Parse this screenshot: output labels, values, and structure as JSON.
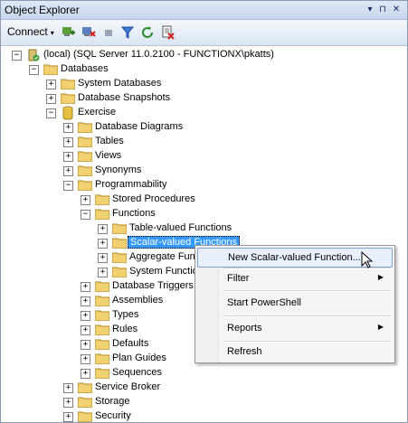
{
  "titlebar": {
    "title": "Object Explorer",
    "pin_glyph": "▾",
    "autohide_glyph": "⊓",
    "close_glyph": "✕"
  },
  "toolbar": {
    "connect_label": "Connect",
    "connect_arrow": "▾",
    "icons": [
      "connect-object-explorer-icon",
      "disconnect-icon",
      "stop-icon",
      "filter-icon",
      "refresh-icon",
      "new-query-icon"
    ]
  },
  "tree": {
    "server": "(local) (SQL Server 11.0.2100 - FUNCTIONX\\pkatts)",
    "databases": "Databases",
    "system_databases": "System Databases",
    "database_snapshots": "Database Snapshots",
    "exercise": "Exercise",
    "database_diagrams": "Database Diagrams",
    "tables": "Tables",
    "views": "Views",
    "synonyms": "Synonyms",
    "programmability": "Programmability",
    "stored_procedures": "Stored Procedures",
    "functions": "Functions",
    "table_valued_functions": "Table-valued Functions",
    "scalar_valued_functions": "Scalar-valued Functions",
    "aggregate_functions": "Aggregate Fun",
    "system_functions": "System Functio",
    "database_triggers": "Database Triggers",
    "assemblies": "Assemblies",
    "types": "Types",
    "rules": "Rules",
    "defaults": "Defaults",
    "plan_guides": "Plan Guides",
    "sequences": "Sequences",
    "service_broker": "Service Broker",
    "storage": "Storage",
    "security": "Security"
  },
  "glyphs": {
    "plus": "+",
    "minus": "−",
    "submenu_arrow": "▶"
  },
  "context_menu": {
    "new_scalar_function": "New Scalar-valued Function...",
    "filter": "Filter",
    "start_powershell": "Start PowerShell",
    "reports": "Reports",
    "refresh": "Refresh"
  },
  "colors": {
    "selection": "#3399ff",
    "menu_highlight": "#e8f0fd",
    "titlebar": "#c7d6ec"
  }
}
